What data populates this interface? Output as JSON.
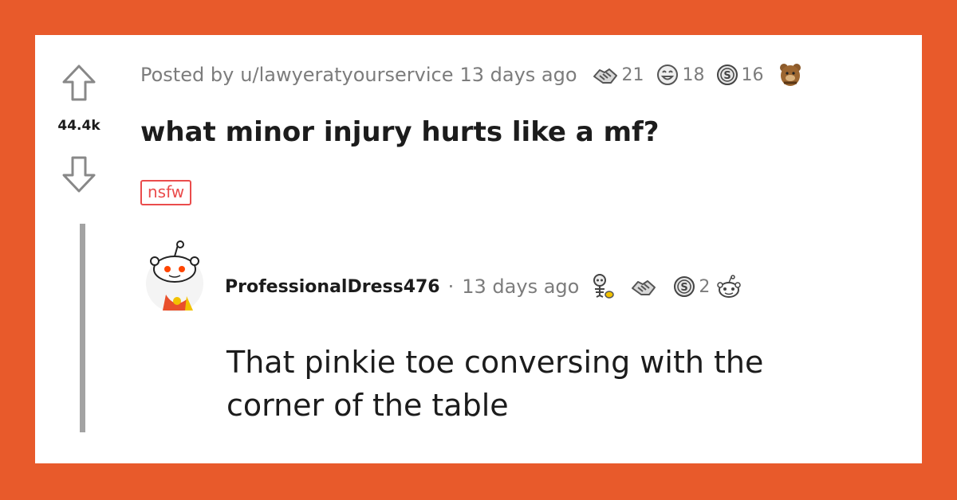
{
  "post": {
    "score": "44.4k",
    "posted_by_prefix": "Posted by",
    "author": "u/lawyeratyourservice",
    "time_ago": "13 days ago",
    "title": "what minor injury hurts like a mf?",
    "tag": "nsfw",
    "awards": [
      {
        "icon": "handshake-award-icon",
        "count": "21"
      },
      {
        "icon": "laughing-face-award-icon",
        "count": "18"
      },
      {
        "icon": "silver-award-icon",
        "count": "16"
      },
      {
        "icon": "bear-award-icon",
        "count": ""
      }
    ]
  },
  "comment": {
    "author": "ProfessionalDress476",
    "separator": "·",
    "time_ago": "13 days ago",
    "awards": [
      {
        "icon": "skeleton-award-icon",
        "count": ""
      },
      {
        "icon": "handshake-award-icon",
        "count": ""
      },
      {
        "icon": "silver-award-icon",
        "count": "2"
      },
      {
        "icon": "snoo-award-icon",
        "count": ""
      }
    ],
    "body": "That pinkie toe conversing with the corner of the table"
  },
  "colors": {
    "frame": "#e85a2b",
    "card": "#ffffff",
    "nsfw": "#ea4c4c",
    "muted": "#7c7c7c",
    "text": "#1c1c1c"
  }
}
